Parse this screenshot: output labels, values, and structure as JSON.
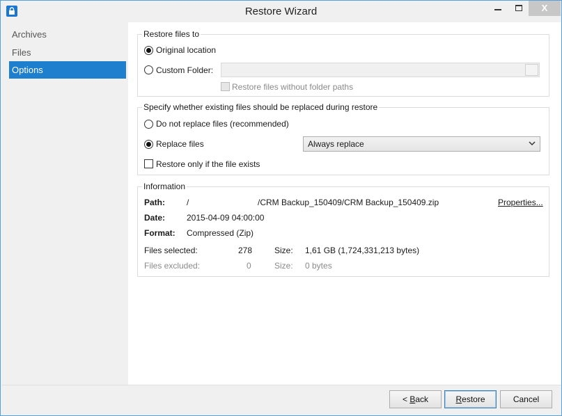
{
  "window": {
    "title": "Restore Wizard",
    "close_label": "X"
  },
  "sidebar": {
    "items": [
      {
        "label": "Archives"
      },
      {
        "label": "Files"
      },
      {
        "label": "Options",
        "selected": true
      }
    ]
  },
  "restore_to": {
    "title": "Restore files to",
    "original_label": "Original location",
    "original_checked": true,
    "custom_label": "Custom Folder:",
    "custom_checked": false,
    "custom_value": "",
    "no_paths_label": "Restore files without folder paths",
    "no_paths_checked": false
  },
  "replace": {
    "title": "Specify whether existing files should be replaced during restore",
    "no_replace_label": "Do not replace files (recommended)",
    "no_replace_checked": false,
    "replace_label": "Replace files",
    "replace_checked": true,
    "replace_mode": "Always replace",
    "only_exists_label": "Restore only if the file exists",
    "only_exists_checked": false
  },
  "information": {
    "title": "Information",
    "path_key": "Path:",
    "path_prefix": "/",
    "path_value": "/CRM Backup_150409/CRM Backup_150409.zip",
    "properties_link": "Properties...",
    "date_key": "Date:",
    "date_value": "2015-04-09 04:00:00",
    "format_key": "Format:",
    "format_value": "Compressed (Zip)",
    "selected_key": "Files selected:",
    "selected_count": "278",
    "selected_size_key": "Size:",
    "selected_size": "1,61 GB (1,724,331,213 bytes)",
    "excluded_key": "Files excluded:",
    "excluded_count": "0",
    "excluded_size_key": "Size:",
    "excluded_size": "0 bytes"
  },
  "footer": {
    "back_prefix": "< ",
    "back_accel": "B",
    "back_rest": "ack",
    "restore_accel": "R",
    "restore_rest": "estore",
    "cancel_label": "Cancel"
  },
  "colors": {
    "accent": "#1e7fcf",
    "window_border": "#5aa0d8"
  }
}
